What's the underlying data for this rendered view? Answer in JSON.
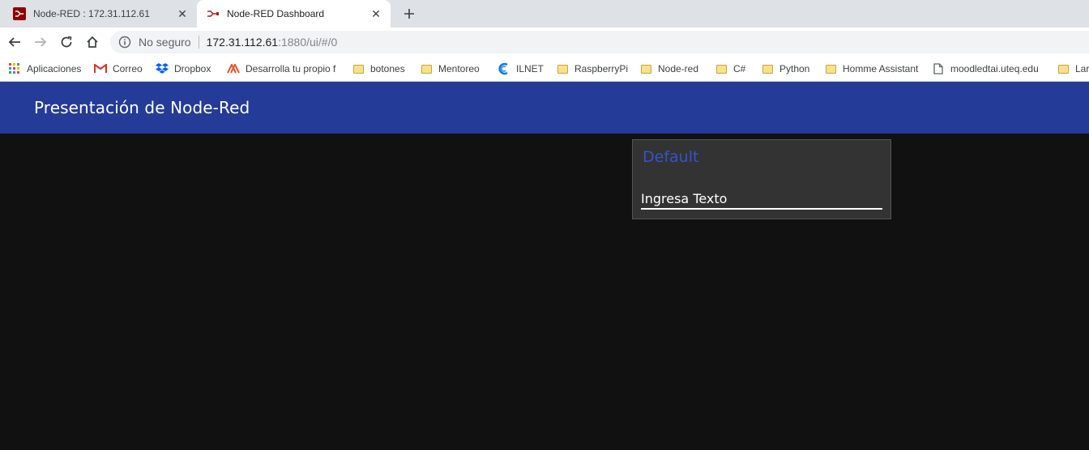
{
  "browser": {
    "tabs": [
      {
        "title": "Node-RED : 172.31.112.61",
        "icon": "node-red-favicon",
        "active": false
      },
      {
        "title": "Node-RED Dashboard",
        "icon": "node-red-dashboard-favicon",
        "active": true
      }
    ],
    "close_glyph": "✕",
    "new_tab_glyph": "+",
    "address": {
      "security_label": "No seguro",
      "host": "172.31.112.61",
      "path": ":1880/ui/#/0"
    },
    "bookmarks": [
      {
        "label": "Aplicaciones",
        "icon": "apps-grid-icon"
      },
      {
        "label": "Correo",
        "icon": "gmail-icon"
      },
      {
        "label": "Dropbox",
        "icon": "dropbox-icon"
      },
      {
        "label": "Desarrolla tu propio f",
        "icon": "site-icon"
      },
      {
        "label": "botones",
        "icon": "folder-icon"
      },
      {
        "label": "Mentoreo",
        "icon": "folder-icon"
      },
      {
        "label": "ILNET",
        "icon": "ilnet-icon"
      },
      {
        "label": "RaspberryPi",
        "icon": "folder-icon"
      },
      {
        "label": "Node-red",
        "icon": "folder-icon"
      },
      {
        "label": "C#",
        "icon": "folder-icon"
      },
      {
        "label": "Python",
        "icon": "folder-icon"
      },
      {
        "label": "Homme Assistant",
        "icon": "folder-icon"
      },
      {
        "label": "moodledtai.uteq.edu",
        "icon": "page-icon"
      },
      {
        "label": "Lar",
        "icon": "folder-icon"
      }
    ]
  },
  "dashboard": {
    "title": "Presentación de Node-Red",
    "group": {
      "title": "Default",
      "input_placeholder": "Ingresa Texto",
      "input_value": ""
    }
  },
  "colors": {
    "toolbar": "#243b98",
    "background": "#111111",
    "card": "#333333",
    "group_title": "#3553c9"
  }
}
